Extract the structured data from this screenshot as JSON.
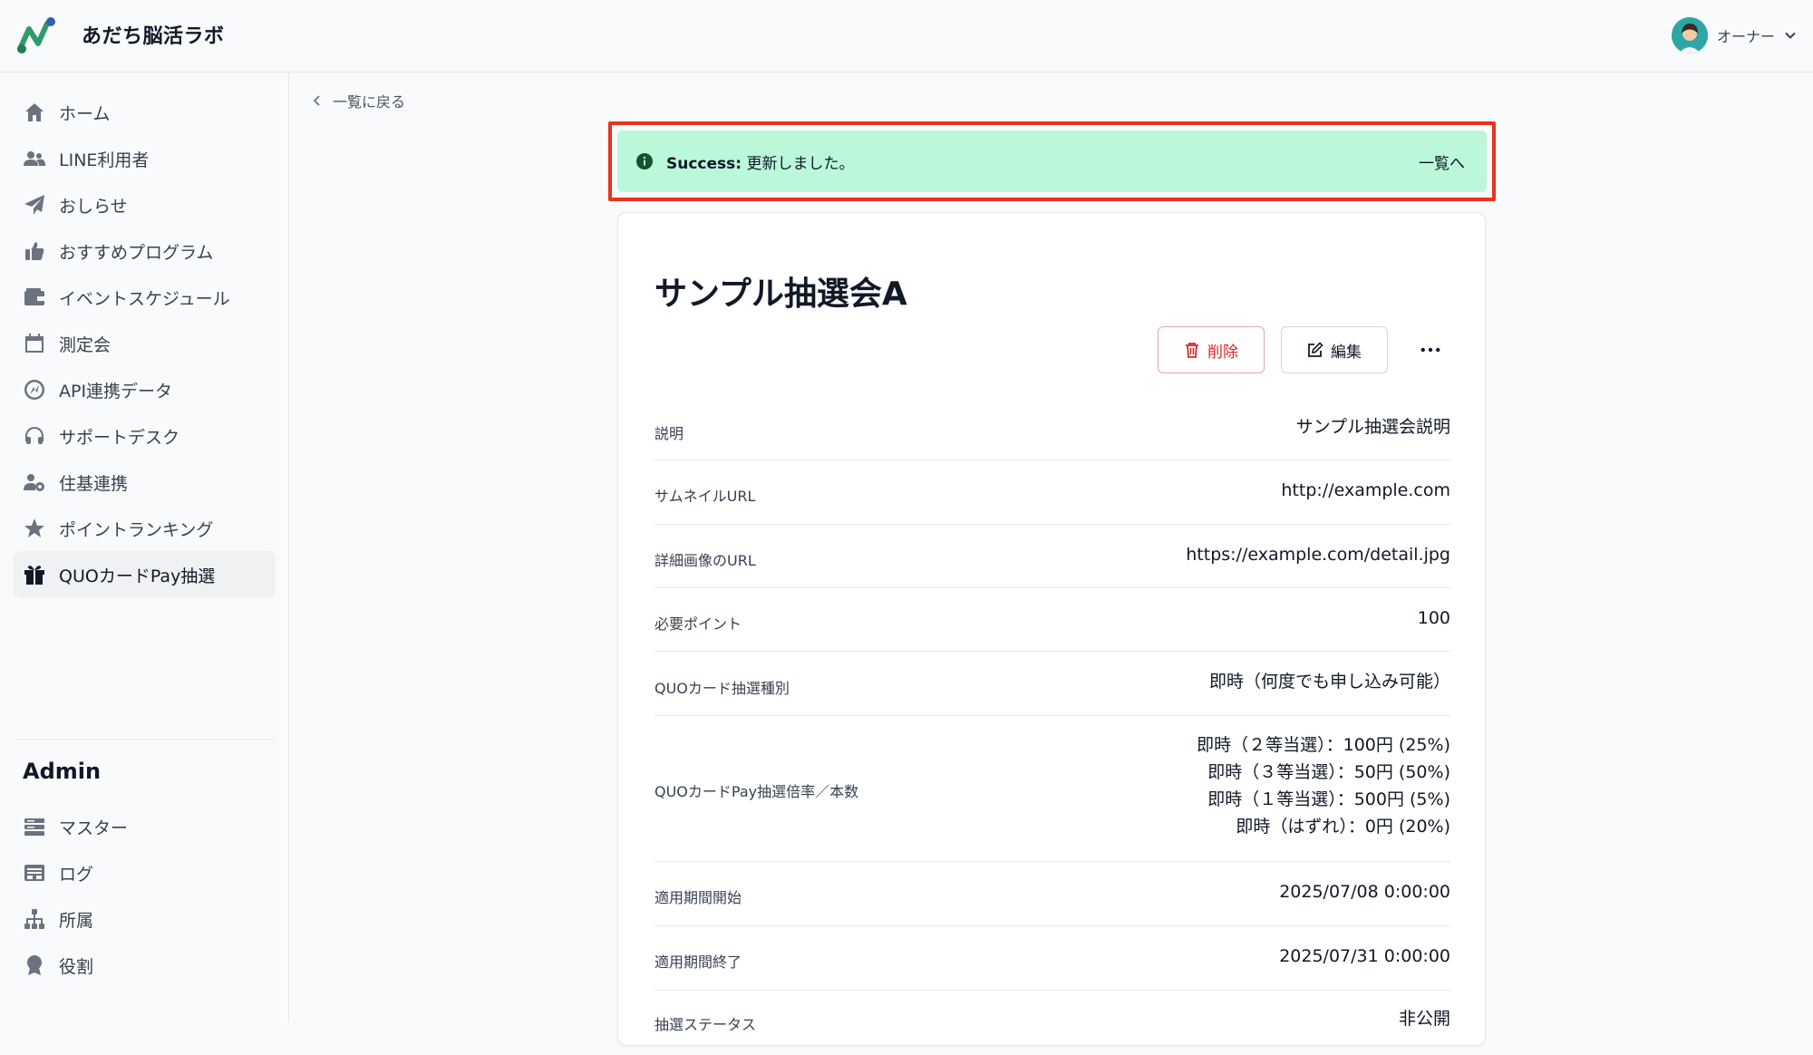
{
  "header": {
    "app_title": "あだち脳活ラボ",
    "user_name": "オーナー"
  },
  "sidebar": {
    "items": [
      {
        "label": "ホーム",
        "icon": "home-icon"
      },
      {
        "label": "LINE利用者",
        "icon": "users-icon"
      },
      {
        "label": "おしらせ",
        "icon": "paper-plane-icon"
      },
      {
        "label": "おすすめプログラム",
        "icon": "thumbs-up-icon"
      },
      {
        "label": "イベントスケジュール",
        "icon": "wallet-icon"
      },
      {
        "label": "測定会",
        "icon": "calendar-icon"
      },
      {
        "label": "API連携データ",
        "icon": "api-icon"
      },
      {
        "label": "サポートデスク",
        "icon": "headset-icon"
      },
      {
        "label": "住基連携",
        "icon": "user-gear-icon"
      },
      {
        "label": "ポイントランキング",
        "icon": "star-icon"
      },
      {
        "label": "QUOカードPay抽選",
        "icon": "gift-icon"
      }
    ],
    "active_index": 10,
    "admin_title": "Admin",
    "admin_items": [
      {
        "label": "マスター",
        "icon": "server-icon"
      },
      {
        "label": "ログ",
        "icon": "log-icon"
      },
      {
        "label": "所属",
        "icon": "sitemap-icon"
      },
      {
        "label": "役割",
        "icon": "award-icon"
      }
    ]
  },
  "main": {
    "back_label": "一覧に戻る",
    "alert": {
      "prefix": "Success:",
      "message": " 更新しました。",
      "link_label": "一覧へ",
      "background_color": "#bbf7d9",
      "highlight_color": "#e8321f"
    },
    "title": "サンプル抽選会A",
    "delete_label": "削除",
    "edit_label": "編集",
    "details": [
      {
        "label": "説明",
        "value": [
          "サンプル抽選会説明"
        ]
      },
      {
        "label": "サムネイルURL",
        "value": [
          "http://example.com"
        ]
      },
      {
        "label": "詳細画像のURL",
        "value": [
          "https://example.com/detail.jpg"
        ]
      },
      {
        "label": "必要ポイント",
        "value": [
          "100"
        ]
      },
      {
        "label": "QUOカード抽選種別",
        "value": [
          "即時（何度でも申し込み可能）"
        ]
      },
      {
        "label": "QUOカードPay抽選倍率／本数",
        "value": [
          "即時（２等当選）：100円 (25%)",
          "即時（３等当選）：50円 (50%)",
          "即時（１等当選）：500円 (5%)",
          "即時（はずれ）：0円 (20%)"
        ]
      },
      {
        "label": "適用期間開始",
        "value": [
          "2025/07/08 0:00:00"
        ]
      },
      {
        "label": "適用期間終了",
        "value": [
          "2025/07/31 0:00:00"
        ]
      },
      {
        "label": "抽選ステータス",
        "value": [
          "非公開"
        ]
      }
    ]
  }
}
